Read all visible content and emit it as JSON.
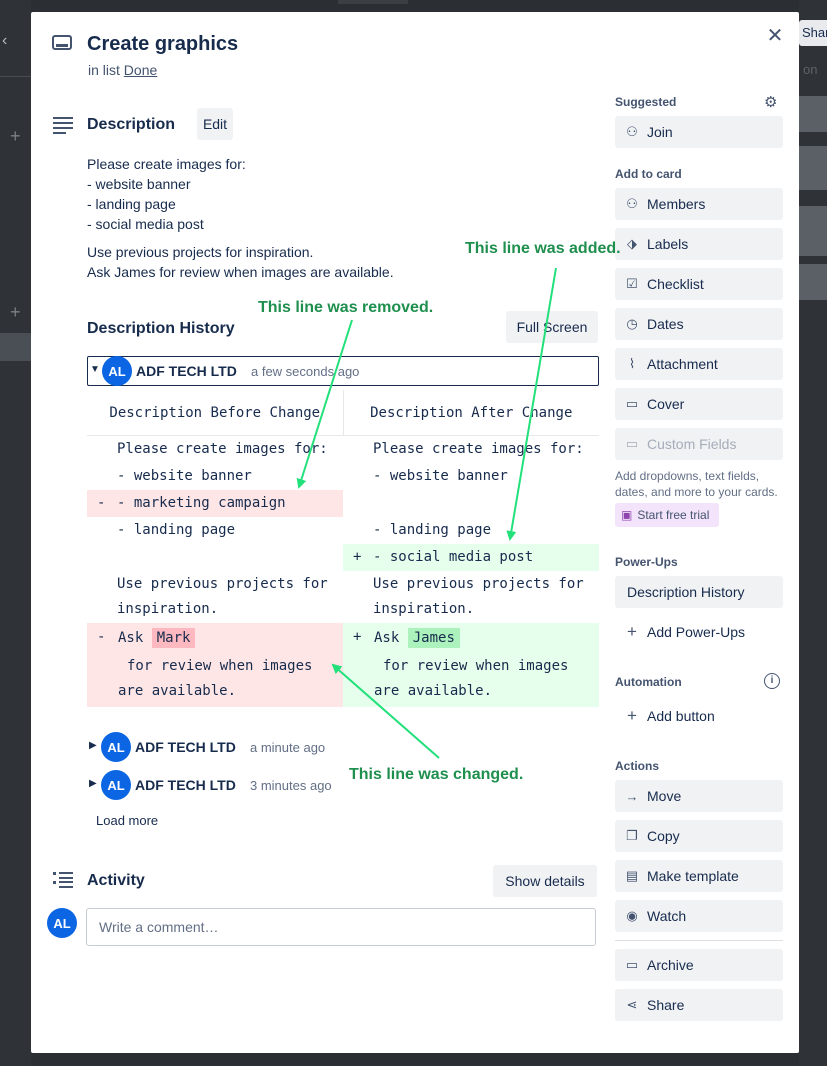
{
  "background": {
    "share_label": "Shar",
    "right_fragment": "on"
  },
  "card": {
    "title": "Create graphics",
    "in_list_prefix": "in list",
    "list_name": "Done"
  },
  "description": {
    "heading": "Description",
    "edit_label": "Edit",
    "lines": [
      "Please create images for:",
      "- website banner",
      "- landing page",
      "- social media post"
    ],
    "lines2": [
      "Use previous projects for inspiration.",
      "Ask James for review when images are available."
    ]
  },
  "history": {
    "heading": "Description History",
    "fullscreen_label": "Full Screen",
    "entries": [
      {
        "initials": "AL",
        "author": "ADF TECH LTD",
        "time": "a few seconds ago"
      },
      {
        "initials": "AL",
        "author": "ADF TECH LTD",
        "time": "a minute ago"
      },
      {
        "initials": "AL",
        "author": "ADF TECH LTD",
        "time": "3 minutes ago"
      }
    ],
    "diff": {
      "before_header": "Description Before Change",
      "after_header": "Description After Change",
      "rows": {
        "r1": {
          "left": "Please create images for:",
          "right": "Please create images for:"
        },
        "r2": {
          "left": "- website banner",
          "right": "- website banner"
        },
        "r3": {
          "sign": "-",
          "left": "- marketing campaign"
        },
        "r4": {
          "left": "- landing page",
          "right": "- landing page"
        },
        "r5": {
          "sign": "+",
          "right": "- social media post"
        },
        "r6": {
          "left1": "Use previous projects for",
          "left2": "inspiration.",
          "right1": "Use previous projects for",
          "right2": "inspiration."
        },
        "r7": {
          "left_sign": "-",
          "right_sign": "+",
          "ask": "Ask",
          "left_name": "Mark",
          "right_name": "James",
          "rest1": "for review when images",
          "rest2": "are available."
        }
      }
    },
    "load_more": "Load more"
  },
  "activity": {
    "heading": "Activity",
    "show_details": "Show details",
    "comment_placeholder": "Write a comment…",
    "initials": "AL"
  },
  "sidebar": {
    "suggested_label": "Suggested",
    "join": "Join",
    "add_to_card_label": "Add to card",
    "members": "Members",
    "labels": "Labels",
    "checklist": "Checklist",
    "dates": "Dates",
    "attachment": "Attachment",
    "cover": "Cover",
    "custom_fields": "Custom Fields",
    "custom_fields_note": "Add dropdowns, text fields, dates, and more to your cards.",
    "free_trial": "Start free trial",
    "powerups_label": "Power-Ups",
    "description_history": "Description History",
    "add_powerups": "Add Power-Ups",
    "automation_label": "Automation",
    "add_button": "Add button",
    "actions_label": "Actions",
    "move": "Move",
    "copy": "Copy",
    "make_template": "Make template",
    "watch": "Watch",
    "archive": "Archive",
    "share": "Share"
  },
  "annotations": {
    "removed": "This line was removed.",
    "added": "This line was added.",
    "changed": "This line was changed.",
    "color": "#1f8f4e",
    "arrow_color": "#22e07a"
  }
}
